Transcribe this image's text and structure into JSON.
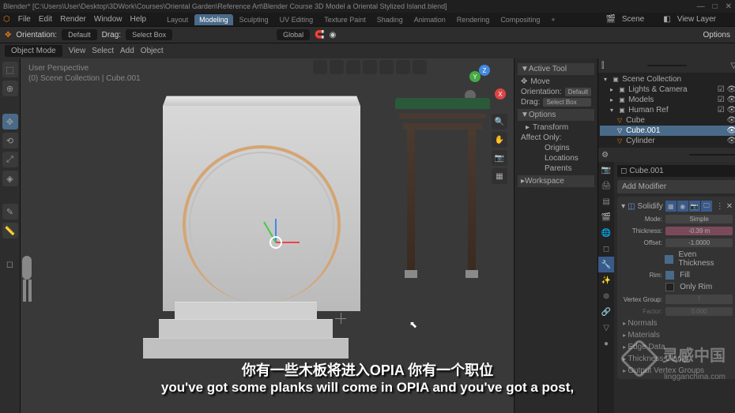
{
  "title": "Blender* [C:\\Users\\User\\Desktop\\3DWork\\Courses\\Oriental Garden\\Reference Art\\Blender Course 3D Model a Oriental Stylized Island.blend]",
  "menu": {
    "items": [
      "File",
      "Edit",
      "Render",
      "Window",
      "Help"
    ]
  },
  "workspaces": {
    "items": [
      "Layout",
      "Modeling",
      "Sculpting",
      "UV Editing",
      "Texture Paint",
      "Shading",
      "Animation",
      "Rendering",
      "Compositing",
      "+"
    ],
    "active": "Modeling"
  },
  "scenebar": {
    "scene_label": "Scene",
    "viewlayer_label": "View Layer"
  },
  "toolbar": {
    "orientation": "Orientation:",
    "default": "Default",
    "drag": "Drag:",
    "selectbox": "Select Box",
    "global": "Global",
    "options": "Options"
  },
  "header": {
    "mode": "Object Mode",
    "menus": [
      "View",
      "Select",
      "Add",
      "Object"
    ]
  },
  "viewport": {
    "persp": "User Perspective",
    "collection": "(0) Scene Collection | Cube.001"
  },
  "npanel": {
    "active_tool": "Active Tool",
    "move": "Move",
    "orientation": "Orientation:",
    "orientation_val": "Default",
    "drag": "Drag:",
    "drag_val": "Select Box",
    "options": "Options",
    "transform": "Transform",
    "affect_only": "Affect Only:",
    "origins": "Origins",
    "locations": "Locations",
    "parents": "Parents",
    "workspace": "Workspace"
  },
  "outliner": {
    "scene_collection": "Scene Collection",
    "items": [
      {
        "name": "Lights & Camera",
        "icon": "▣",
        "indent": 1
      },
      {
        "name": "Models",
        "icon": "▣",
        "indent": 1
      },
      {
        "name": "Human Ref",
        "icon": "▣",
        "indent": 1
      },
      {
        "name": "Cube",
        "icon": "▽",
        "indent": 2
      },
      {
        "name": "Cube.001",
        "icon": "▽",
        "indent": 2,
        "selected": true
      },
      {
        "name": "Cylinder",
        "icon": "▽",
        "indent": 2
      }
    ]
  },
  "props": {
    "object": "Cube.001",
    "add_modifier": "Add Modifier",
    "modifier": {
      "name": "Solidify",
      "mode_label": "Mode:",
      "mode": "Simple",
      "thickness_label": "Thickness:",
      "thickness": "-0.39 m",
      "offset_label": "Offset:",
      "offset": "-1.0000",
      "even_thickness": "Even Thickness",
      "rim_label": "Rim:",
      "fill": "Fill",
      "only_rim": "Only Rim",
      "vertex_group_label": "Vertex Group:",
      "factor_label": "Factor:",
      "factor": "0.000",
      "sections": [
        "Normals",
        "Materials",
        "Edge Data",
        "Thickness Clamp",
        "Output Vertex Groups"
      ]
    }
  },
  "subtitle": {
    "cn": "你有一些木板将进入OPIA 你有一个职位",
    "en": "you've got some planks will come in OPIA and you've got a post,"
  },
  "watermark": {
    "big": "灵感中国",
    "small": "lingganchina.com"
  }
}
